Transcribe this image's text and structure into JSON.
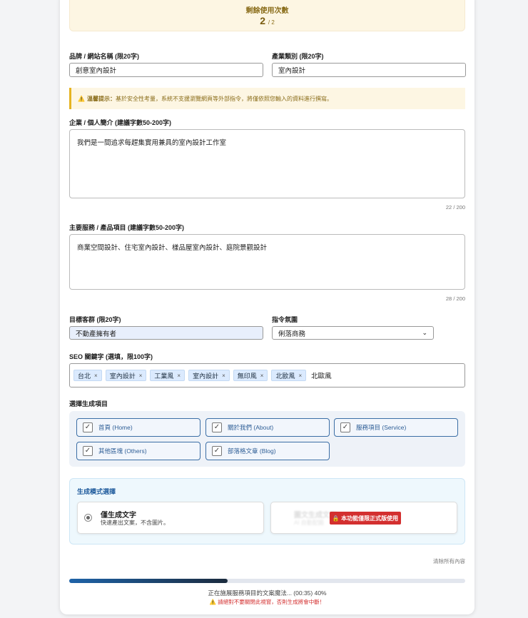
{
  "quota": {
    "title": "剩餘使用次數",
    "remaining": "2",
    "total": "/ 2"
  },
  "brand": {
    "label": "品牌 / 網站名稱 (限20字)",
    "value": "創意室內設計"
  },
  "industry": {
    "label": "產業類別 (限20字)",
    "value": "室內設計"
  },
  "notice": {
    "icon": "warning-icon",
    "title": "溫馨提示：",
    "text": "基於安全性考量，系統不支援瀏覽網頁等外部指令，將僅依照您輸入的資料進行撰寫。"
  },
  "intro": {
    "label": "企業 / 個人簡介 (建議字數50-200字)",
    "value": "我們是一間追求每趕集實用兼具的室內設計工作室",
    "count": "22 / 200"
  },
  "services": {
    "label": "主要服務 / 產品項目 (建議字數50-200字)",
    "value": "商業空間設計、住宅室內設計、樣品屋室內設計、庭院景觀設計",
    "count": "28 / 200"
  },
  "audience": {
    "label": "目標客群 (限20字)",
    "value": "不動產擁有者"
  },
  "tone": {
    "label": "指令氛圍",
    "value": "俐落商務"
  },
  "seo": {
    "label": "SEO 關鍵字 (選填，限100字)",
    "tags": [
      "台北",
      "室內設計",
      "工業風",
      "室內設計",
      "無印風",
      "北歐風"
    ],
    "input": "北歐風"
  },
  "items": {
    "label": "選擇生成項目",
    "options": [
      "首頁 (Home)",
      "關於我們 (About)",
      "服務項目 (Service)",
      "其他區塊 (Others)",
      "部落格文章 (Blog)"
    ]
  },
  "mode": {
    "label": "生成模式選擇",
    "text_title": "僅生成文字",
    "text_desc": "快速產出文案，不含圖片。",
    "image_title": "圖文生成文案",
    "image_desc": "AI 自動配圖",
    "locked": "🔒 本功能僅限正式版使用"
  },
  "clear": "清除所有內容",
  "progress": {
    "percent": 40,
    "status": "正在施展服務項目的文案魔法... (00:35) 40%",
    "warning": "⚠️ 請絕對不要關閉此視窗，否則生成將會中斷！"
  }
}
